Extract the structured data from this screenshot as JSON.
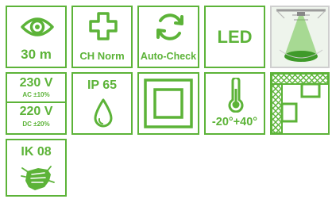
{
  "colors": {
    "accent": "#5cb338",
    "background": "#ffffff",
    "lamp_light": "#6ec24a"
  },
  "tiles": {
    "distance": {
      "icon": "eye-icon",
      "label": "30 m"
    },
    "ch_norm": {
      "icon": "swiss-cross-icon",
      "label": "CH Norm"
    },
    "auto_check": {
      "icon": "refresh-arrows-icon",
      "label": "Auto-Check"
    },
    "led": {
      "label": "LED"
    },
    "light_cone": {
      "icon": "ceiling-lamp-light-icon"
    },
    "voltage": {
      "ac_value": "230 V",
      "ac_sub": "AC ±10%",
      "dc_value": "220 V",
      "dc_sub": "DC ±20%"
    },
    "ip": {
      "label": "IP 65",
      "icon": "water-drop-icon"
    },
    "double_insulation": {
      "icon": "double-square-icon"
    },
    "temperature": {
      "icon": "thermometer-icon",
      "label": "-20°+40°"
    },
    "mounting": {
      "icon": "wall-ceiling-mount-icon"
    },
    "ik": {
      "label": "IK 08",
      "icon": "fist-impact-icon"
    }
  }
}
